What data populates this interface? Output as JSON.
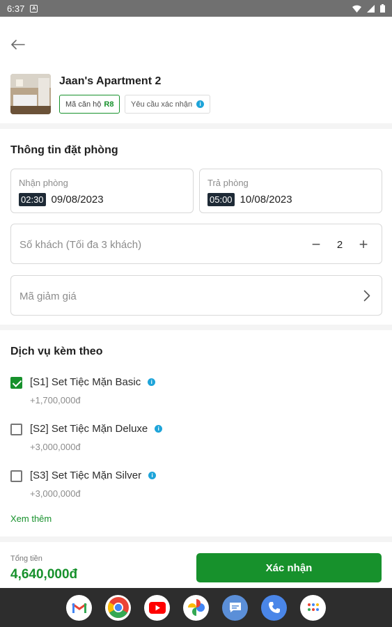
{
  "status_bar": {
    "time": "6:37",
    "notification_icon": "A"
  },
  "hotel": {
    "name": "Jaan's Apartment 2",
    "code_label": "Mã căn hộ",
    "code_value": "R8",
    "confirm_label": "Yêu cầu xác nhận"
  },
  "booking": {
    "title": "Thông tin đặt phòng",
    "checkin": {
      "label": "Nhận phòng",
      "time": "02:30",
      "date": "09/08/2023"
    },
    "checkout": {
      "label": "Trả phòng",
      "time": "05:00",
      "date": "10/08/2023"
    },
    "guests": {
      "placeholder": "Số khách (Tối đa 3 khách)",
      "count": "2",
      "minus": "−",
      "plus": "+"
    },
    "discount": {
      "placeholder": "Mã giảm giá"
    }
  },
  "services": {
    "title": "Dịch vụ kèm theo",
    "items": [
      {
        "name": "[S1] Set Tiệc Mặn Basic",
        "price": "+1,700,000đ",
        "checked": true
      },
      {
        "name": "[S2] Set Tiệc Mặn Deluxe",
        "price": "+3,000,000đ",
        "checked": false
      },
      {
        "name": "[S3] Set Tiệc Mặn Silver",
        "price": "+3,000,000đ",
        "checked": false
      }
    ],
    "see_more": "Xem thêm"
  },
  "footer": {
    "total_label": "Tổng tiền",
    "total_value": "4,640,000đ",
    "confirm_label": "Xác nhận"
  },
  "colors": {
    "accent": "#17912c",
    "info": "#1ea4d9",
    "chip": "#1e2a36"
  },
  "dock": [
    "gmail-icon",
    "chrome-icon",
    "youtube-icon",
    "photos-icon",
    "messages-icon",
    "phone-icon",
    "apps-icon"
  ]
}
